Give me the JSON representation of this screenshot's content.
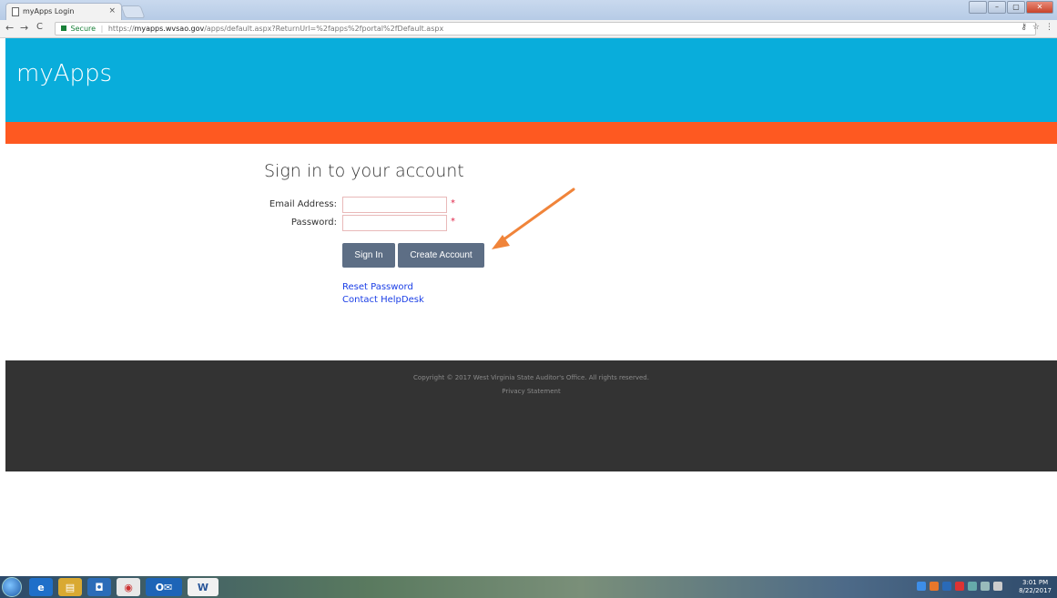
{
  "browser": {
    "tab_title": "myApps Login",
    "tab_close": "×",
    "nav_back": "←",
    "nav_forward": "→",
    "nav_reload": "C",
    "secure_label": "Secure",
    "url_scheme": "https://",
    "url_host": "myapps.wvsao.gov",
    "url_path": "/apps/default.aspx?ReturnUrl=%2fapps%2fportal%2fDefault.aspx",
    "toolbar_icons": [
      "key-icon",
      "star-icon",
      "menu-icon"
    ]
  },
  "header": {
    "brand": "myApps",
    "colors": {
      "primary": "#09addb",
      "accent": "#fe5921"
    }
  },
  "signin": {
    "title": "Sign in to your account",
    "email_label": "Email Address:",
    "email_value": "",
    "password_label": "Password:",
    "password_value": "",
    "required_marker": "*",
    "signin_button": "Sign In",
    "create_button": "Create Account",
    "reset_link": "Reset Password",
    "helpdesk_link": "Contact HelpDesk",
    "annotation": "arrow-pointing-to-create-account"
  },
  "footer": {
    "copyright": "Copyright © 2017 West Virginia State Auditor's Office. All rights reserved.",
    "privacy": "Privacy Statement"
  },
  "taskbar": {
    "apps": [
      "internet-explorer-icon",
      "file-explorer-icon",
      "outlook-icon",
      "chrome-icon",
      "outlook-mail-icon",
      "word-icon"
    ],
    "time": "3:01 PM",
    "date": "8/22/2017"
  }
}
